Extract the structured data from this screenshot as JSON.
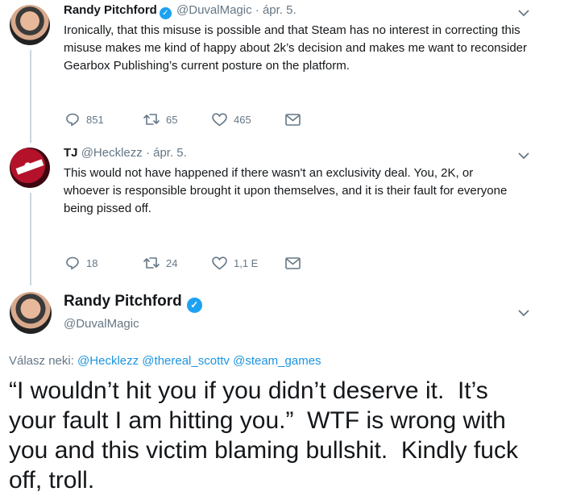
{
  "tweet1": {
    "name": "Randy Pitchford",
    "handle": "@DuvalMagic",
    "dot": "·",
    "date": "ápr. 5.",
    "text": "Ironically, that this misuse is possible and that Steam has no interest in correcting this misuse makes me kind of happy about 2k’s decision and makes me want to reconsider Gearbox Publishing’s current posture on the platform.",
    "replies": "851",
    "retweets": "65",
    "likes": "465"
  },
  "tweet2": {
    "name": "TJ",
    "handle": "@Hecklezz",
    "dot": "·",
    "date": "ápr. 5.",
    "text": "This would not have happened if there wasn't an exclusivity deal. You, 2K, or whoever is responsible brought it upon themselves, and it is their fault for everyone being pissed off.",
    "replies": "18",
    "retweets": "24",
    "likes": "1,1 E"
  },
  "focus": {
    "name": "Randy Pitchford",
    "handle": "@DuvalMagic",
    "reply_prefix": "Válasz neki:",
    "mentions": [
      "@Hecklezz",
      "@thereal_scottv",
      "@steam_games"
    ],
    "text": "“I wouldn’t hit you if you didn’t deserve it.  It’s your fault I am hitting you.”  WTF is wrong with you and this victim blaming bullshit.  Kindly fuck off, troll."
  },
  "icons": {
    "reply": "reply-icon",
    "retweet": "retweet-icon",
    "like": "heart-icon",
    "dm": "envelope-icon",
    "more": "chevron-down-icon",
    "verified": "verified-badge-icon"
  },
  "colors": {
    "link": "#1b95e0",
    "verified": "#1da1f2",
    "muted": "#657786",
    "thread_line": "#ccd6dd"
  }
}
